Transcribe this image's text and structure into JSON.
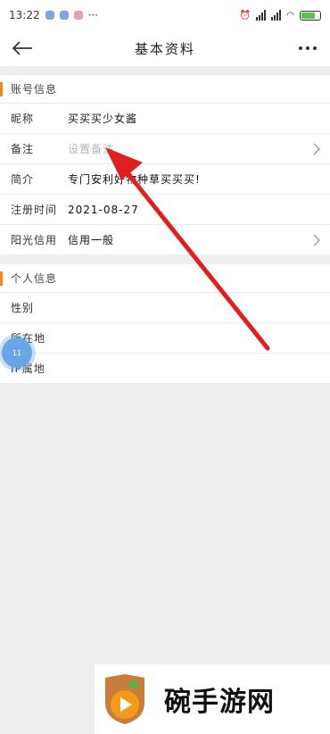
{
  "status_bar": {
    "time": "13:22",
    "more": "···",
    "battery": ""
  },
  "header": {
    "title": "基本资料"
  },
  "account_section": {
    "title": "账号信息",
    "rows": [
      {
        "label": "昵称",
        "value": "买买买少女酱"
      },
      {
        "label": "备注",
        "value": "设置备注",
        "placeholder": true
      },
      {
        "label": "简介",
        "value": "专门安利好物种草买买买!"
      },
      {
        "label": "注册时间",
        "value": "2021-08-27"
      },
      {
        "label": "阳光信用",
        "value": "信用一般"
      }
    ]
  },
  "personal_section": {
    "title": "个人信息",
    "rows": [
      {
        "label": "性别",
        "value": ""
      },
      {
        "label": "所在地",
        "value": ""
      },
      {
        "label": "IP属地",
        "value": ""
      }
    ]
  },
  "floating_bubble": {
    "text": "11"
  },
  "watermark": {
    "text": "碗手游网"
  },
  "colors": {
    "accent": "#f08a1c",
    "arrow": "#e02020",
    "bubble": "#6aa5e6"
  }
}
